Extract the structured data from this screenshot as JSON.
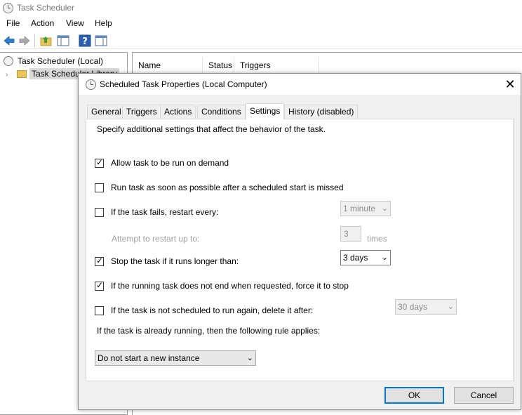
{
  "app": {
    "title": "Task Scheduler"
  },
  "menu": [
    "File",
    "Action",
    "View",
    "Help"
  ],
  "toolbar": {
    "buttons": [
      "back-arrow-icon",
      "forward-arrow-icon",
      "folder-up-icon",
      "show-hide-tree-icon",
      "help-icon",
      "action-pane-icon"
    ]
  },
  "tree": {
    "root": "Task Scheduler (Local)",
    "child": "Task Scheduler Library"
  },
  "list": {
    "columns": [
      "Name",
      "Status",
      "Triggers"
    ]
  },
  "dialog": {
    "title": "Scheduled Task Properties (Local Computer)",
    "close_glyph": "✕",
    "tabs": [
      "General",
      "Triggers",
      "Actions",
      "Conditions",
      "Settings",
      "History (disabled)"
    ],
    "active_tab": "Settings",
    "description": "Specify additional settings that affect the behavior of the task.",
    "settings": {
      "run_on_demand": {
        "label": "Allow task to be run on demand",
        "checked": true
      },
      "run_asap": {
        "label": "Run task as soon as possible after a scheduled start is missed",
        "checked": false
      },
      "restart_on_fail": {
        "label": "If the task fails, restart every:",
        "checked": false,
        "value": "1 minute"
      },
      "restart_attempts": {
        "label": "Attempt to restart up to:",
        "value": "3",
        "unit": "times"
      },
      "stop_if_longer": {
        "label": "Stop the task if it runs longer than:",
        "checked": true,
        "value": "3 days"
      },
      "force_stop": {
        "label": "If the running task does not end when requested, force it to stop",
        "checked": true
      },
      "delete_if_not_scheduled": {
        "label": "If the task is not scheduled to run again, delete it after:",
        "checked": false,
        "value": "30 days"
      },
      "rule_label": "If the task is already running, then the following rule applies:",
      "rule_value": "Do not start a new instance"
    },
    "ok_label": "OK",
    "cancel_label": "Cancel"
  },
  "colors": {
    "accent": "#0078d7",
    "dialog_bg": "#f0f0f0",
    "disabled_text": "#a0a0a0"
  }
}
